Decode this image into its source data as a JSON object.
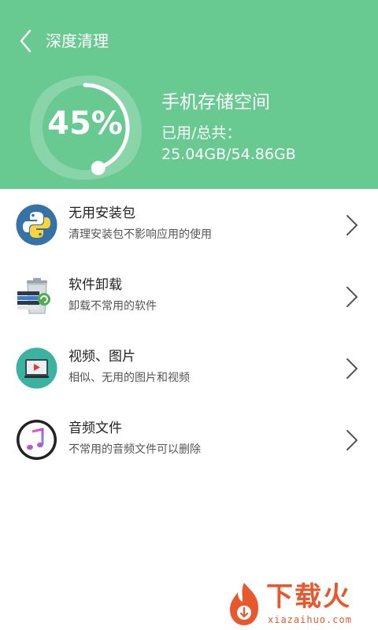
{
  "header": {
    "title": "深度清理",
    "gauge_value": "45%",
    "gauge_fraction": 0.45,
    "storage_title": "手机存储空间",
    "storage_label": "已用/总共：",
    "storage_value": "25.04GB/54.86GB"
  },
  "items": [
    {
      "title": "无用安装包",
      "subtitle": "清理安装包不影响应用的使用",
      "icon": "python-package-icon"
    },
    {
      "title": "软件卸载",
      "subtitle": "卸载不常用的软件",
      "icon": "recycle-bin-icon"
    },
    {
      "title": "视频、图片",
      "subtitle": "相似、无用的图片和视频",
      "icon": "video-player-icon"
    },
    {
      "title": "音频文件",
      "subtitle": "不常用的音频文件可以删除",
      "icon": "music-note-icon"
    }
  ],
  "watermark": {
    "text": "下载火",
    "domain": "xiazaihuo.com"
  },
  "colors": {
    "header": "#68c991",
    "accent": "#e8582d"
  }
}
